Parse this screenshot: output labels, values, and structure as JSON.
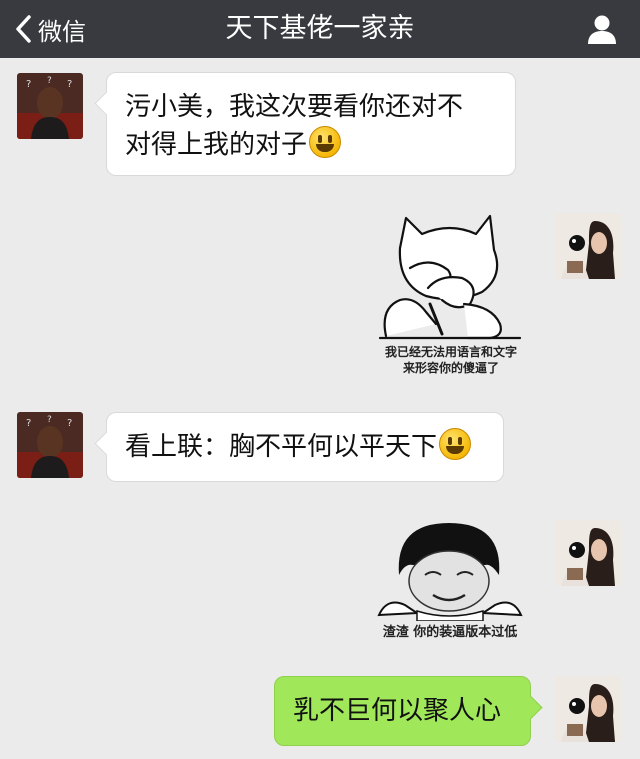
{
  "navbar": {
    "back_label": "微信",
    "title": "天下基佬一家亲"
  },
  "messages": [
    {
      "sender": "other",
      "lines": [
        "污小美，我这次要看你还对不",
        "对得上我的对子"
      ],
      "emoji": "smiley"
    },
    {
      "sender": "me",
      "type": "sticker",
      "caption_lines": [
        "我已经无法用语言和文字",
        "来形容你的傻逼了"
      ]
    },
    {
      "sender": "other",
      "lines": [
        "看上联：胸不平何以平天下"
      ],
      "emoji": "smiley"
    },
    {
      "sender": "me",
      "type": "sticker",
      "caption_lines": [
        "渣渣 你的装逼版本过低"
      ]
    },
    {
      "sender": "me",
      "lines": [
        "乳不巨何以聚人心"
      ]
    }
  ]
}
